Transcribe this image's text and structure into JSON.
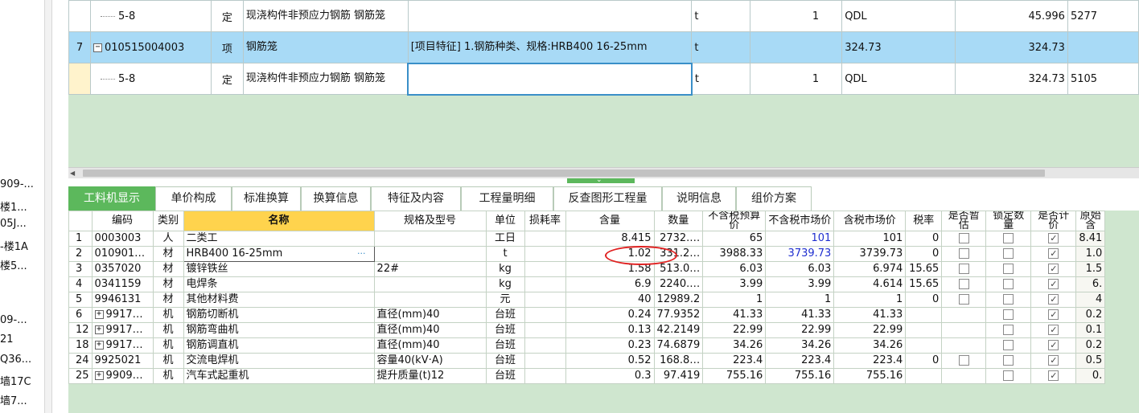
{
  "left_panel": {
    "items": [
      "909-...",
      "楼1...",
      "05J...",
      "-楼1A",
      "楼5...",
      "09-...",
      "21",
      "Q36...",
      "墙17C",
      "墙7..."
    ]
  },
  "top_table": {
    "rows": [
      {
        "no": "",
        "code": "5-8",
        "type": "定",
        "name": "现浇构件非预应力钢筋 钢筋笼",
        "feature": "",
        "unit": "t",
        "qty1": "1",
        "expr": "QDL",
        "qty2": "45.996",
        "extra": "5277",
        "kind": "sub"
      },
      {
        "no": "7",
        "code": "010515004003",
        "type": "项",
        "name": "钢筋笼",
        "feature": "[项目特征]\n1.钢筋种类、规格:HRB400 16-25mm",
        "unit": "t",
        "qty1": "",
        "expr": "324.73",
        "qty2": "324.73",
        "extra": "",
        "kind": "item"
      },
      {
        "no": "",
        "code": "5-8",
        "type": "定",
        "name": "现浇构件非预应力钢筋 钢筋笼",
        "feature": "",
        "unit": "t",
        "qty1": "1",
        "expr": "QDL",
        "qty2": "324.73",
        "extra": "5105",
        "kind": "sub-current"
      }
    ]
  },
  "tabs": [
    "工料机显示",
    "单价构成",
    "标准换算",
    "换算信息",
    "特征及内容",
    "工程量明细",
    "反查图形工程量",
    "说明信息",
    "组价方案"
  ],
  "bottom_table": {
    "headers": [
      "",
      "编码",
      "类别",
      "名称",
      "规格及型号",
      "单位",
      "损耗率",
      "含量",
      "数量",
      "不含税预算价",
      "不含税市场价",
      "含税市场价",
      "税率",
      "是否暂估",
      "锁定数量",
      "是否计价",
      "原始含"
    ],
    "rows": [
      {
        "no": "1",
        "code": "0003003",
        "cat": "人",
        "name": "二类工",
        "spec": "",
        "unit": "工日",
        "loss": "",
        "content": "8.415",
        "qty": "2732.…",
        "budget": "65",
        "market": "101",
        "tax_market": "101",
        "rate": "0",
        "est": false,
        "lock": false,
        "priced": true,
        "orig": "8.41",
        "toggle": false
      },
      {
        "no": "2",
        "code": "010901…",
        "cat": "材",
        "name": "HRB400 16-25mm",
        "spec": "",
        "unit": "t",
        "loss": "",
        "content": "1.02",
        "qty": "331.2…",
        "budget": "3988.33",
        "market": "3739.73",
        "tax_market": "3739.73",
        "rate": "0",
        "est": false,
        "lock": false,
        "priced": true,
        "orig": "1.0",
        "toggle": false
      },
      {
        "no": "3",
        "code": "0357020",
        "cat": "材",
        "name": "镀锌铁丝",
        "spec": "22#",
        "unit": "kg",
        "loss": "",
        "content": "1.58",
        "qty": "513.0…",
        "budget": "6.03",
        "market": "6.03",
        "tax_market": "6.974",
        "rate": "15.65",
        "est": false,
        "lock": false,
        "priced": true,
        "orig": "1.5",
        "toggle": false
      },
      {
        "no": "4",
        "code": "0341159",
        "cat": "材",
        "name": "电焊条",
        "spec": "",
        "unit": "kg",
        "loss": "",
        "content": "6.9",
        "qty": "2240.…",
        "budget": "3.99",
        "market": "3.99",
        "tax_market": "4.614",
        "rate": "15.65",
        "est": false,
        "lock": false,
        "priced": true,
        "orig": "6.",
        "toggle": false
      },
      {
        "no": "5",
        "code": "9946131",
        "cat": "材",
        "name": "其他材料费",
        "spec": "",
        "unit": "元",
        "loss": "",
        "content": "40",
        "qty": "12989.2",
        "budget": "1",
        "market": "1",
        "tax_market": "1",
        "rate": "0",
        "est": false,
        "lock": false,
        "priced": true,
        "orig": "4",
        "toggle": false
      },
      {
        "no": "6",
        "code": "9917…",
        "cat": "机",
        "name": "钢筋切断机",
        "spec": "直径(mm)40",
        "unit": "台班",
        "loss": "",
        "content": "0.24",
        "qty": "77.9352",
        "budget": "41.33",
        "market": "41.33",
        "tax_market": "41.33",
        "rate": "",
        "est": null,
        "lock": false,
        "priced": true,
        "orig": "0.2",
        "toggle": true
      },
      {
        "no": "12",
        "code": "9917…",
        "cat": "机",
        "name": "钢筋弯曲机",
        "spec": "直径(mm)40",
        "unit": "台班",
        "loss": "",
        "content": "0.13",
        "qty": "42.2149",
        "budget": "22.99",
        "market": "22.99",
        "tax_market": "22.99",
        "rate": "",
        "est": null,
        "lock": false,
        "priced": true,
        "orig": "0.1",
        "toggle": true
      },
      {
        "no": "18",
        "code": "9917…",
        "cat": "机",
        "name": "钢筋调直机",
        "spec": "直径(mm)40",
        "unit": "台班",
        "loss": "",
        "content": "0.23",
        "qty": "74.6879",
        "budget": "34.26",
        "market": "34.26",
        "tax_market": "34.26",
        "rate": "",
        "est": null,
        "lock": false,
        "priced": true,
        "orig": "0.2",
        "toggle": true
      },
      {
        "no": "24",
        "code": "9925021",
        "cat": "机",
        "name": "交流电焊机",
        "spec": "容量40(kV·A)",
        "unit": "台班",
        "loss": "",
        "content": "0.52",
        "qty": "168.8…",
        "budget": "223.4",
        "market": "223.4",
        "tax_market": "223.4",
        "rate": "0",
        "est": false,
        "lock": false,
        "priced": true,
        "orig": "0.5",
        "toggle": false
      },
      {
        "no": "25",
        "code": "9909…",
        "cat": "机",
        "name": "汽车式起重机",
        "spec": "提升质量(t)12",
        "unit": "台班",
        "loss": "",
        "content": "0.3",
        "qty": "97.419",
        "budget": "755.16",
        "market": "755.16",
        "tax_market": "755.16",
        "rate": "",
        "est": null,
        "lock": false,
        "priced": true,
        "orig": "0.",
        "toggle": true
      }
    ]
  },
  "colors": {
    "accent_green": "#5cb85c",
    "selected_blue": "#a8daf6",
    "panel_green": "#cfe6cf",
    "market_blue": "#1f2fcf",
    "annotation_red": "#e02020"
  }
}
